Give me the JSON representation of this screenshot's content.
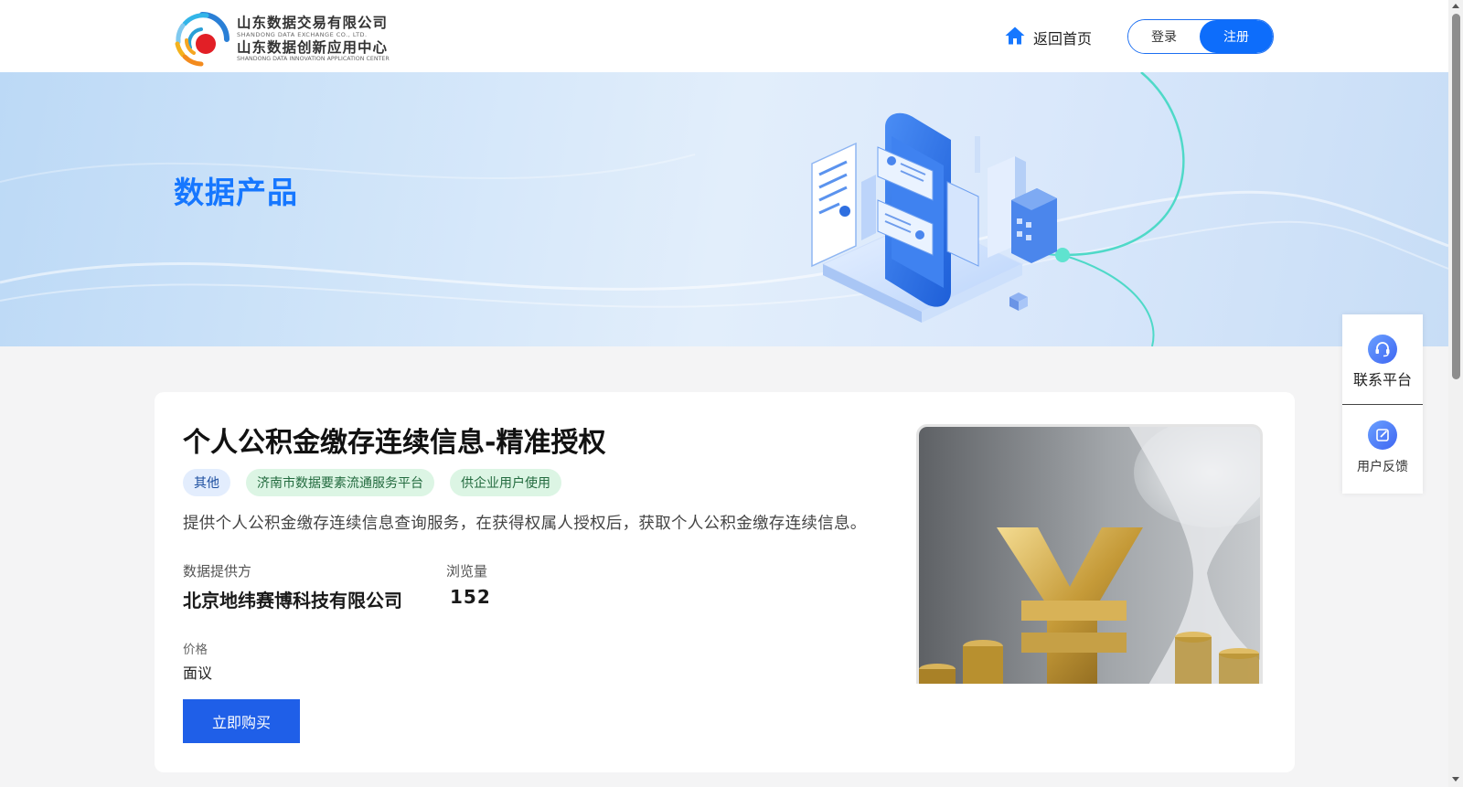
{
  "header": {
    "logo": {
      "line1_cn": "山东数据交易有限公司",
      "line1_en": "SHANDONG DATA EXCHANGE CO., LTD.",
      "line2_cn": "山东数据创新应用中心",
      "line2_en": "SHANDONG DATA INNOVATION APPLICATION CENTER"
    },
    "home_label": "返回首页",
    "login_label": "登录",
    "register_label": "注册"
  },
  "banner": {
    "title": "数据产品"
  },
  "product": {
    "title": "个人公积金缴存连续信息-精准授权",
    "tags": [
      "其他",
      "济南市数据要素流通服务平台",
      "供企业用户使用"
    ],
    "description": "提供个人公积金缴存连续信息查询服务，在获得权属人授权后，获取个人公积金缴存连续信息。",
    "provider_label": "数据提供方",
    "provider_value": "北京地纬赛博科技有限公司",
    "views_label": "浏览量",
    "views_value": "152",
    "price_label": "价格",
    "price_value": "面议",
    "buy_label": "立即购买"
  },
  "float_panel": {
    "contact_label": "联系平台",
    "feedback_label": "用户反馈"
  },
  "colors": {
    "accent": "#1677ff",
    "buy_button": "#1f5fe8",
    "register_button": "#0d6dfb"
  },
  "icons": [
    "logo-mark",
    "home-icon",
    "headset-icon",
    "edit-icon"
  ]
}
